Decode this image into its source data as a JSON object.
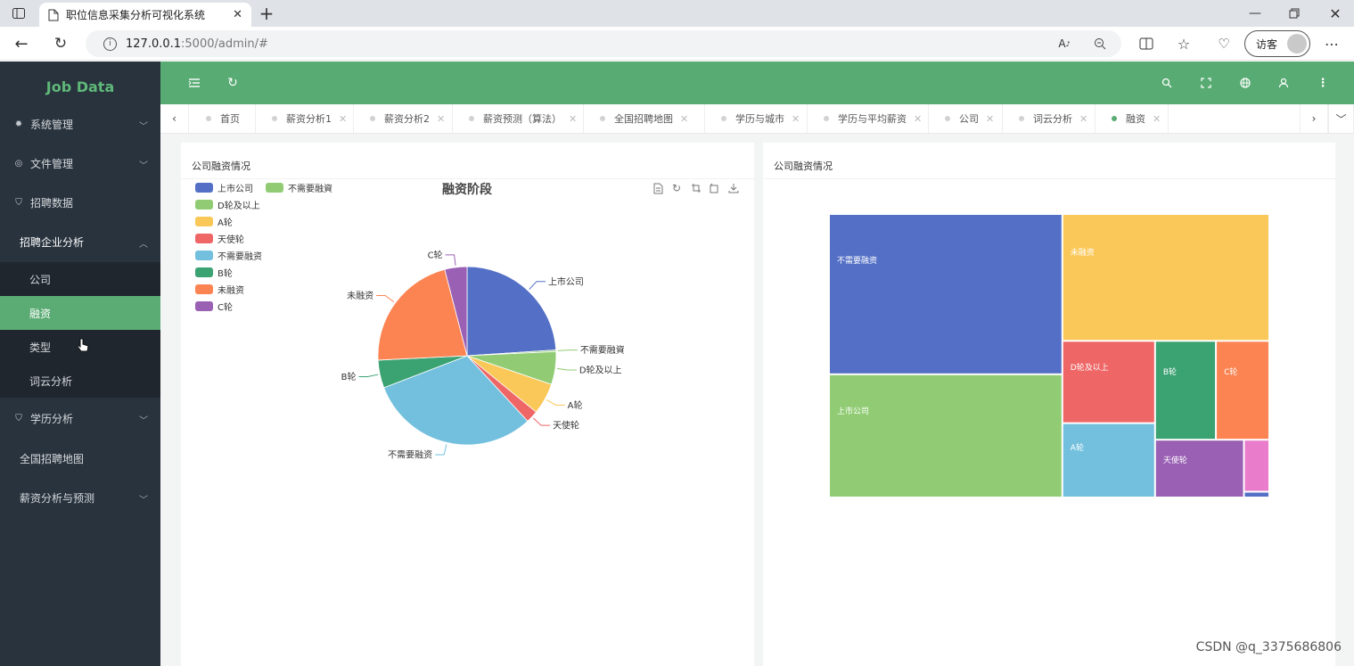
{
  "browser": {
    "tab_title": "职位信息采集分析可视化系统",
    "url_host": "127.0.0.1",
    "url_rest": ":5000/admin/#",
    "profile_label": "访客",
    "icons": [
      "sidebar-toggle-icon",
      "page-icon",
      "close-icon",
      "plus-icon",
      "back-icon",
      "reload-icon",
      "info-icon",
      "read-aloud-icon",
      "zoom-icon",
      "split-screen-icon",
      "favorites-icon",
      "browser-essentials-icon",
      "more-icon",
      "minimize-icon",
      "restore-icon",
      "close-window-icon"
    ]
  },
  "sidebar": {
    "logo": "Job Data",
    "items": [
      {
        "label": "系统管理",
        "icon": "gear-icon",
        "expandable": true
      },
      {
        "label": "文件管理",
        "icon": "camera-icon",
        "expandable": true
      },
      {
        "label": "招聘数据",
        "icon": "shield-icon",
        "expandable": false
      },
      {
        "label": "招聘企业分析",
        "icon": "",
        "expandable": true,
        "expanded": true
      },
      {
        "label": "学历分析",
        "icon": "shield-icon",
        "expandable": true
      },
      {
        "label": "全国招聘地图",
        "icon": "",
        "expandable": false
      },
      {
        "label": "薪资分析与预测",
        "icon": "",
        "expandable": true
      }
    ],
    "subitems": [
      {
        "label": "公司",
        "active": false
      },
      {
        "label": "融资",
        "active": true
      },
      {
        "label": "类型",
        "active": false
      },
      {
        "label": "词云分析",
        "active": false
      }
    ]
  },
  "header": {
    "icons": [
      "menu-fold-icon",
      "refresh-icon",
      "search-icon",
      "fullscreen-icon",
      "globe-icon",
      "user-icon",
      "more-vertical-icon"
    ]
  },
  "tabs": [
    {
      "label": "首页",
      "closable": false,
      "active": false
    },
    {
      "label": "薪资分析1",
      "closable": true,
      "active": false
    },
    {
      "label": "薪资分析2",
      "closable": true,
      "active": false
    },
    {
      "label": "薪资预测（算法）",
      "closable": true,
      "active": false
    },
    {
      "label": "全国招聘地图",
      "closable": true,
      "active": false
    },
    {
      "label": "学历与城市",
      "closable": true,
      "active": false
    },
    {
      "label": "学历与平均薪资",
      "closable": true,
      "active": false
    },
    {
      "label": "公司",
      "closable": true,
      "active": false
    },
    {
      "label": "词云分析",
      "closable": true,
      "active": false
    },
    {
      "label": "融资",
      "closable": true,
      "active": true
    }
  ],
  "cards": {
    "left_title": "公司融资情况",
    "right_title": "公司融资情况"
  },
  "chart_data": [
    {
      "type": "pie",
      "title": "融资阶段",
      "legend": [
        "上市公司",
        "不需要融資",
        "D轮及以上",
        "A轮",
        "天使轮",
        "不需要融资",
        "B轮",
        "未融资",
        "C轮"
      ],
      "slices": [
        {
          "name": "上市公司",
          "value": 23.7,
          "color": "#5470c6"
        },
        {
          "name": "不需要融資",
          "value": 0.3,
          "color": "#91cc75"
        },
        {
          "name": "D轮及以上",
          "value": 5.9,
          "color": "#91cc75"
        },
        {
          "name": "A轮",
          "value": 5.6,
          "color": "#fac858"
        },
        {
          "name": "天使轮",
          "value": 2.2,
          "color": "#ee6666"
        },
        {
          "name": "不需要融资",
          "value": 30.7,
          "color": "#73c0de"
        },
        {
          "name": "B轮",
          "value": 5.0,
          "color": "#3ba272"
        },
        {
          "name": "未融资",
          "value": 21.5,
          "color": "#fc8452"
        },
        {
          "name": "C轮",
          "value": 4.0,
          "color": "#9a60b4"
        }
      ],
      "toolbox": [
        "data-view-icon",
        "restore-icon",
        "magic-icon",
        "magic-alt-icon",
        "save-image-icon"
      ]
    },
    {
      "type": "treemap",
      "nodes": [
        {
          "name": "不需要融资",
          "value": 255,
          "color": "#5470c6"
        },
        {
          "name": "上市公司",
          "value": 196,
          "color": "#91cc75"
        },
        {
          "name": "未融资",
          "value": 179,
          "color": "#fac858"
        },
        {
          "name": "D轮及以上",
          "value": 52,
          "color": "#ee6666"
        },
        {
          "name": "A轮",
          "value": 47,
          "color": "#73c0de"
        },
        {
          "name": "B轮",
          "value": 41,
          "color": "#3ba272"
        },
        {
          "name": "C轮",
          "value": 36,
          "color": "#fc8452"
        },
        {
          "name": "天使轮",
          "value": 35,
          "color": "#9a60b4"
        },
        {
          "name": "",
          "value": 9,
          "color": "#ea7ccc"
        },
        {
          "name": "",
          "value": 1,
          "color": "#5470c6"
        }
      ]
    }
  ],
  "watermark": "CSDN @q_3375686806"
}
